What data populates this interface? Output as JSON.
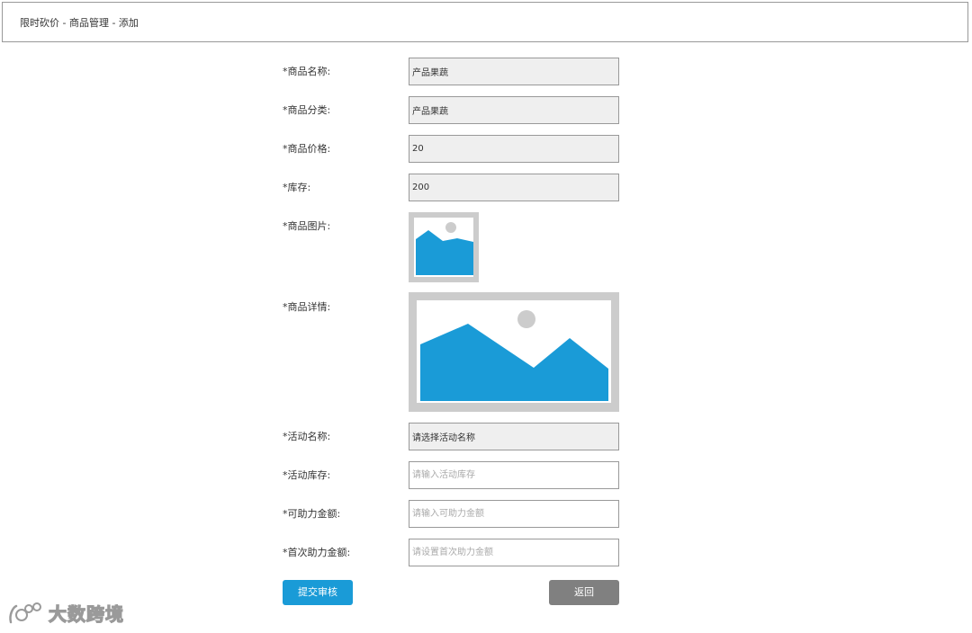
{
  "breadcrumb": {
    "text": "限时砍价 - 商品管理 - 添加"
  },
  "form": {
    "product_name": {
      "label": "*商品名称:",
      "value": "产品果蔬"
    },
    "product_category": {
      "label": "*商品分类:",
      "value": "产品果蔬"
    },
    "product_price": {
      "label": "*商品价格:",
      "value": "20"
    },
    "stock": {
      "label": "*库存:",
      "value": "200"
    },
    "product_image": {
      "label": "*商品图片:"
    },
    "product_detail": {
      "label": "*商品详情:"
    },
    "activity_name": {
      "label": "*活动名称:",
      "value": "请选择活动名称"
    },
    "activity_stock": {
      "label": "*活动库存:",
      "placeholder": "请输入活动库存"
    },
    "assist_amount": {
      "label": "*可助力金额:",
      "placeholder": "请输入可助力金额"
    },
    "first_assist_amount": {
      "label": "*首次助力金额:",
      "placeholder": "请设置首次助力金额"
    }
  },
  "buttons": {
    "submit_label": "提交审核",
    "back_label": "返回"
  },
  "watermark": {
    "text": "大数跨境"
  },
  "colors": {
    "accent": "#1a9bd7",
    "gray_button": "#808080",
    "readonly_field_bg": "#efefef",
    "image_frame": "#cccccc",
    "image_fill": "#1a9bd7"
  },
  "icons": {
    "image_placeholder": "image-placeholder-icon",
    "watermark_logo": "logo-icon"
  }
}
